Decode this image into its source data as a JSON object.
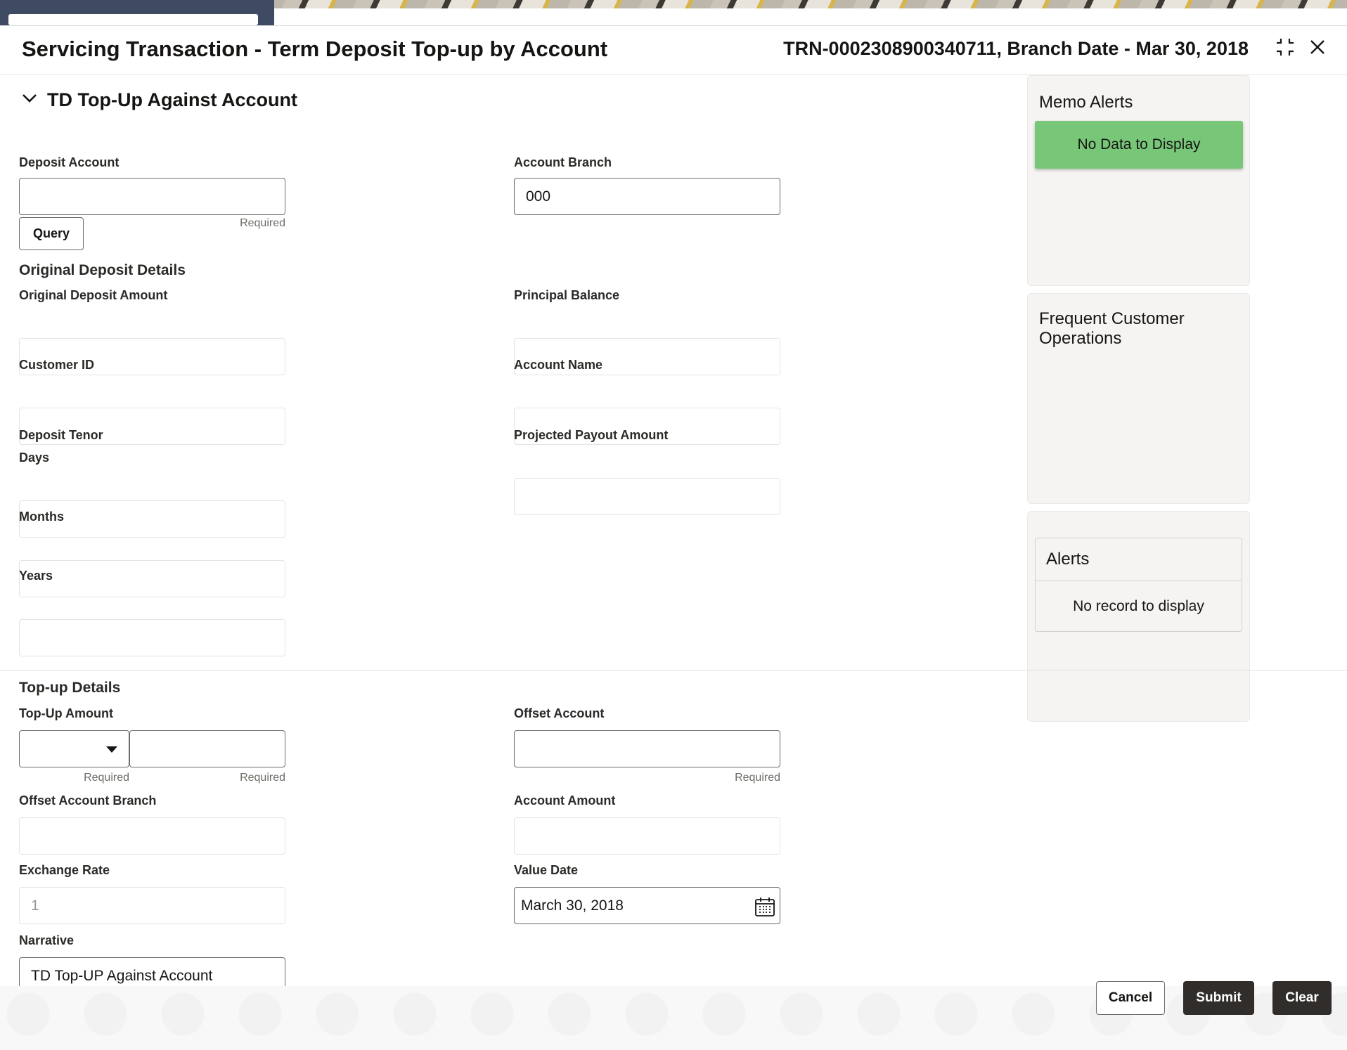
{
  "dialog": {
    "title": "Servicing Transaction - Term Deposit Top-up by Account",
    "reference": "TRN-0002308900340711, Branch Date - Mar 30, 2018"
  },
  "section": {
    "title": "TD Top-Up Against Account"
  },
  "fields": {
    "deposit_account": {
      "label": "Deposit Account",
      "value": "",
      "hint": "Required"
    },
    "account_branch": {
      "label": "Account Branch",
      "value": "000"
    },
    "query_button": "Query",
    "original_deposit_details": "Original Deposit Details",
    "original_deposit_amount": {
      "label": "Original Deposit Amount",
      "value": ""
    },
    "principal_balance": {
      "label": "Principal Balance",
      "value": ""
    },
    "customer_id": {
      "label": "Customer ID",
      "value": ""
    },
    "account_name": {
      "label": "Account Name",
      "value": ""
    },
    "deposit_tenor": "Deposit Tenor",
    "days": {
      "label": "Days",
      "value": ""
    },
    "months": {
      "label": "Months",
      "value": ""
    },
    "years": {
      "label": "Years",
      "value": ""
    },
    "projected_payout_amount": {
      "label": "Projected Payout Amount",
      "value": ""
    },
    "topup_details": "Top-up Details",
    "topup_amount": {
      "label": "Top-Up Amount",
      "currency": "",
      "value": "",
      "currency_hint": "Required",
      "amount_hint": "Required"
    },
    "offset_account": {
      "label": "Offset Account",
      "value": "",
      "hint": "Required"
    },
    "offset_account_branch": {
      "label": "Offset Account Branch",
      "value": ""
    },
    "account_amount": {
      "label": "Account Amount",
      "value": ""
    },
    "exchange_rate": {
      "label": "Exchange Rate",
      "value": "1"
    },
    "value_date": {
      "label": "Value Date",
      "value": "March 30, 2018"
    },
    "narrative": {
      "label": "Narrative",
      "value": "TD Top-UP Against Account"
    }
  },
  "side": {
    "memo_alerts": {
      "title": "Memo Alerts",
      "message": "No Data to Display",
      "color": "#78c778"
    },
    "frequent_ops": {
      "title": "Frequent Customer Operations"
    },
    "alerts": {
      "title": "Alerts",
      "message": "No record to display"
    }
  },
  "footer": {
    "cancel": "Cancel",
    "submit": "Submit",
    "clear": "Clear"
  },
  "icons": [
    "minimize-icon",
    "close-icon",
    "chevron-down-icon",
    "dropdown-caret-icon",
    "calendar-icon"
  ]
}
